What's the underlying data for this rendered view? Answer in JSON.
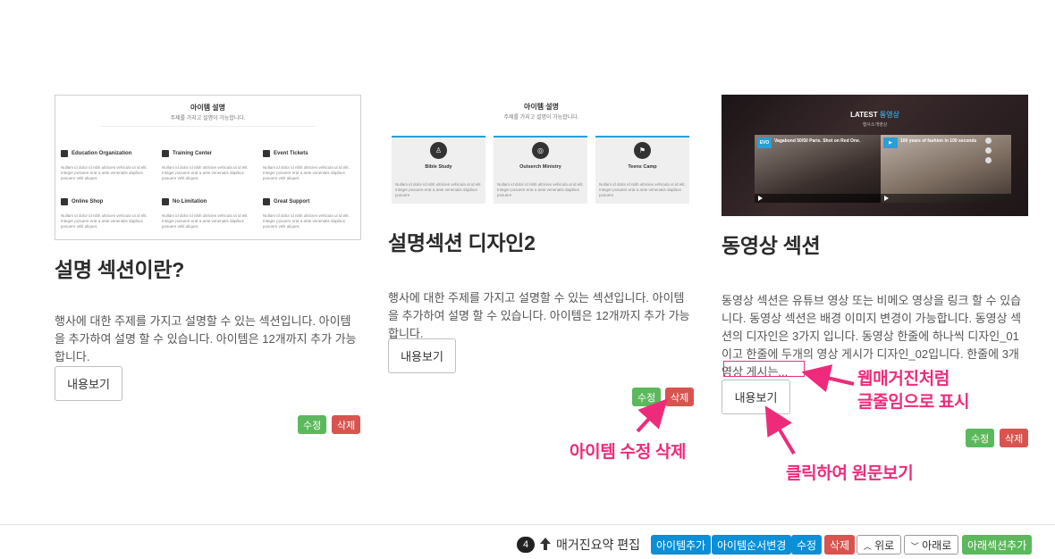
{
  "cards": [
    {
      "title": "설명 섹션이란?",
      "description": "행사에 대한 주제를 가지고 설명할 수 있는 섹션입니다. 아이템을 추가하여 설명 할 수 있습니다. 아이템은 12개까지 추가 가능합니다.",
      "read_label": "내용보기",
      "edit_label": "수정",
      "delete_label": "삭제",
      "thumb": {
        "title": "아이템 설명",
        "subtitle": "주제를 가지고 설명이 가능합니다.",
        "features": [
          {
            "label": "Education Organization",
            "icon": "graduation-icon"
          },
          {
            "label": "Training Center",
            "icon": "paper-plane-icon"
          },
          {
            "label": "Event Tickets",
            "icon": "ticket-icon"
          },
          {
            "label": "Online Shop",
            "icon": "cart-icon"
          },
          {
            "label": "No Limitation",
            "icon": "chart-icon"
          },
          {
            "label": "Great Support",
            "icon": "star-icon"
          }
        ],
        "feature_text": "Nullam id dolor id nibh ultricies vehicula ut id elit. Integer posuere erat a ante venenatis dapibus posuere velit aliquet."
      }
    },
    {
      "title": "설명섹션 디자인2",
      "description": "행사에 대한 주제를 가지고 설명할 수 있는 섹션입니다. 아이템을 추가하여 설명 할 수 있습니다. 아이템은 12개까지 추가 가능합니다.",
      "read_label": "내용보기",
      "edit_label": "수정",
      "delete_label": "삭제",
      "thumb": {
        "title": "아이템 설명",
        "subtitle": "주제를 가지고 설명이 가능합니다.",
        "boxes": [
          {
            "label": "Bible Study",
            "icon": "person-icon"
          },
          {
            "label": "Outserch Ministry",
            "icon": "globe-icon"
          },
          {
            "label": "Teens Camp",
            "icon": "flag-icon"
          }
        ],
        "box_text": "Nullam id dolor id nibh ultricies vehicula ut id elit. Integer posuere erat a ante venenatis dapibus posuere"
      }
    },
    {
      "title": "동영상 섹션",
      "description": "동영상 섹션은 유튜브 영상 또는 비메오 영상을 링크 할 수 있습니다. 동영상 섹션은 배경 이미지 변경이 가능합니다. 동영상 섹션의 디자인은 3가지 입니다. 동영상 한줄에 하나씩 디자인_01이고 한줄에 두개의 영상 게시가 디자인_02입니다. 한줄에 3개 영상 게시는...",
      "read_label": "내용보기",
      "edit_label": "수정",
      "delete_label": "삭제",
      "thumb": {
        "title_pre": "LATEST",
        "title_accent": "동영상",
        "subtitle": "행사소개영상",
        "videos": [
          {
            "title": "Vagabond 50/50 Paris. Shot on Red One.",
            "badge": "EVO"
          },
          {
            "title": "100 years of fashion in 100 seconds",
            "badge": "▶"
          }
        ]
      }
    }
  ],
  "annotations": {
    "webzine": "웹매거진처럼",
    "webzine2": "글줄임으로 표시",
    "item_edit": "아이템 수정 삭제",
    "click_read": "클릭하여 원문보기"
  },
  "toolbar": {
    "count": "4",
    "section_name": "매거진요약 편집",
    "add_item": "아이템추가",
    "reorder_items": "아이템순서변경",
    "edit": "수정",
    "delete": "삭제",
    "up": "위로",
    "down": "아래로",
    "add_section": "아래섹션추가"
  },
  "colors": {
    "accent_pink": "#ee2b7b",
    "green": "#5cb85c",
    "red": "#d9534f",
    "blue": "#0b8fd6"
  }
}
